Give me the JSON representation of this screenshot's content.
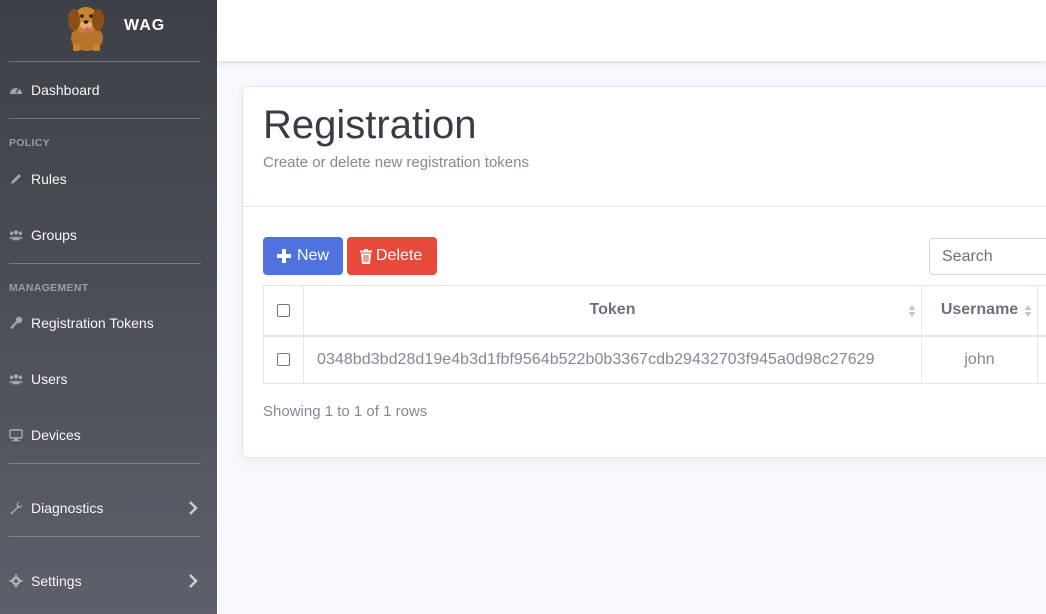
{
  "brand": {
    "name": "WAG",
    "logo_icon": "dog-logo-icon"
  },
  "sidebar": {
    "items": [
      {
        "label": "Dashboard",
        "icon": "tachometer-icon"
      },
      {
        "label": "Rules",
        "icon": "pencil-icon"
      },
      {
        "label": "Groups",
        "icon": "users-icon"
      },
      {
        "label": "Registration Tokens",
        "icon": "key-icon"
      },
      {
        "label": "Users",
        "icon": "users-icon"
      },
      {
        "label": "Devices",
        "icon": "desktop-icon"
      },
      {
        "label": "Diagnostics",
        "icon": "wrench-icon"
      },
      {
        "label": "Settings",
        "icon": "gear-icon"
      }
    ],
    "headings": {
      "policy": "POLICY",
      "management": "MANAGEMENT"
    }
  },
  "page": {
    "title": "Registration",
    "subtitle": "Create or delete new registration tokens"
  },
  "toolbar": {
    "new_label": "New",
    "delete_label": "Delete",
    "search_placeholder": "Search"
  },
  "table": {
    "columns": [
      "Token",
      "Username"
    ],
    "rows": [
      {
        "token": "0348bd3bd28d19e4b3d1fbf9564b522b0b3367cdb29432703f945a0d98c27629",
        "username": "john"
      }
    ],
    "footer": "Showing 1 to 1 of 1 rows"
  },
  "colors": {
    "primary": "#4e73df",
    "danger": "#e74a3b",
    "sidebar_top": "#3d4047",
    "sidebar_bottom": "#5d606a"
  }
}
